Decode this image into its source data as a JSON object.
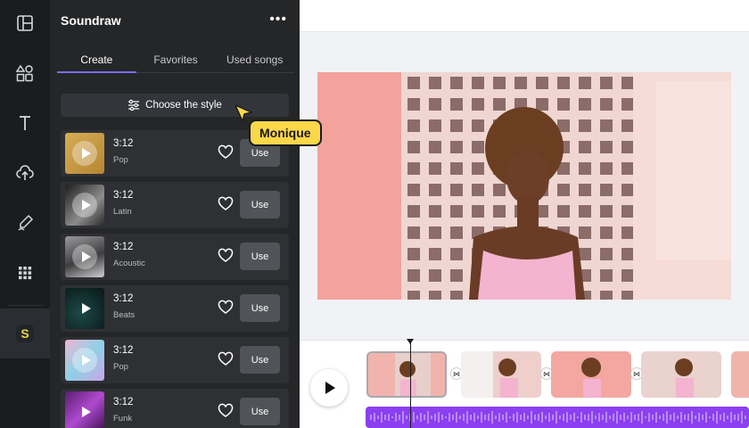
{
  "rail": {
    "items": [
      "layout-icon",
      "elements-icon",
      "text-icon",
      "upload-icon",
      "draw-icon",
      "apps-icon",
      "soundraw-app-icon"
    ],
    "app_badge_letter": "S"
  },
  "panel": {
    "title": "Soundraw",
    "more_icon": "more-horizontal-icon",
    "tabs": [
      {
        "label": "Create",
        "active": true
      },
      {
        "label": "Favorites",
        "active": false
      },
      {
        "label": "Used songs",
        "active": false
      }
    ],
    "style_button": "Choose the style",
    "songs": [
      {
        "time": "3:12",
        "genre": "Pop",
        "use_label": "Use",
        "thumb_color": "#c99b45"
      },
      {
        "time": "3:12",
        "genre": "Latin",
        "use_label": "Use",
        "thumb_color": "#3a3a3a"
      },
      {
        "time": "3:12",
        "genre": "Acoustic",
        "use_label": "Use",
        "thumb_color": "#6e6e70"
      },
      {
        "time": "3:12",
        "genre": "Beats",
        "use_label": "Use",
        "thumb_color": "#0f2a2a"
      },
      {
        "time": "3:12",
        "genre": "Pop",
        "use_label": "Use",
        "thumb_color": "#9fc7d8"
      },
      {
        "time": "3:12",
        "genre": "Funk",
        "use_label": "Use",
        "thumb_color": "#7a2a8a"
      }
    ]
  },
  "collaborator": {
    "name": "Monique",
    "color": "#fbd74a"
  },
  "colors": {
    "accent": "#7d6cf6",
    "audio_track": "#8b3ff0",
    "panel_bg": "#252627"
  }
}
